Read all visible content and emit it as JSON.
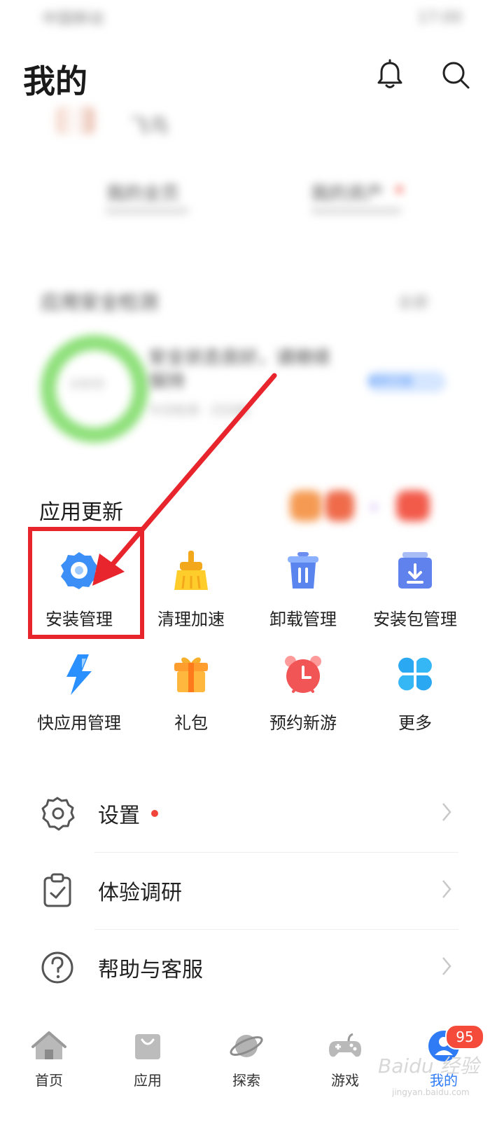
{
  "status_bar": {
    "carrier": "中国移动",
    "time": "17:00"
  },
  "header": {
    "title": "我的"
  },
  "profile": {
    "name": "飞鸟"
  },
  "stats": [
    {
      "label": "我的全页"
    },
    {
      "label": "我的资产"
    }
  ],
  "security": {
    "title": "应用安全检测",
    "more": "全部",
    "score": "100分",
    "desc": "安全状态良好，请继续保持",
    "sub": "今日检测 · 已扫描",
    "button": "重新扫描"
  },
  "app_update": {
    "title": "应用更新"
  },
  "tools": [
    {
      "label": "安装管理",
      "icon": "gear-icon"
    },
    {
      "label": "清理加速",
      "icon": "broom-icon"
    },
    {
      "label": "卸载管理",
      "icon": "trash-icon"
    },
    {
      "label": "安装包管理",
      "icon": "package-download-icon"
    },
    {
      "label": "快应用管理",
      "icon": "lightning-icon"
    },
    {
      "label": "礼包",
      "icon": "gift-icon"
    },
    {
      "label": "预约新游",
      "icon": "alarm-clock-icon"
    },
    {
      "label": "更多",
      "icon": "four-leaf-grid-icon"
    }
  ],
  "menu": [
    {
      "label": "设置",
      "icon": "settings-outline-icon",
      "dot": true
    },
    {
      "label": "体验调研",
      "icon": "clipboard-check-icon"
    },
    {
      "label": "帮助与客服",
      "icon": "help-circle-icon"
    }
  ],
  "nav": [
    {
      "label": "首页",
      "icon": "home-icon"
    },
    {
      "label": "应用",
      "icon": "bag-icon"
    },
    {
      "label": "探索",
      "icon": "planet-icon"
    },
    {
      "label": "游戏",
      "icon": "gamepad-icon"
    },
    {
      "label": "我的",
      "icon": "user-icon",
      "badge": "95",
      "active": true
    }
  ],
  "watermark": {
    "text": "Baidu 经验",
    "sub": "jingyan.baidu.com"
  },
  "colors": {
    "accent": "#2f7bf6",
    "highlight": "#e8242c",
    "badge": "#f44b3b"
  }
}
